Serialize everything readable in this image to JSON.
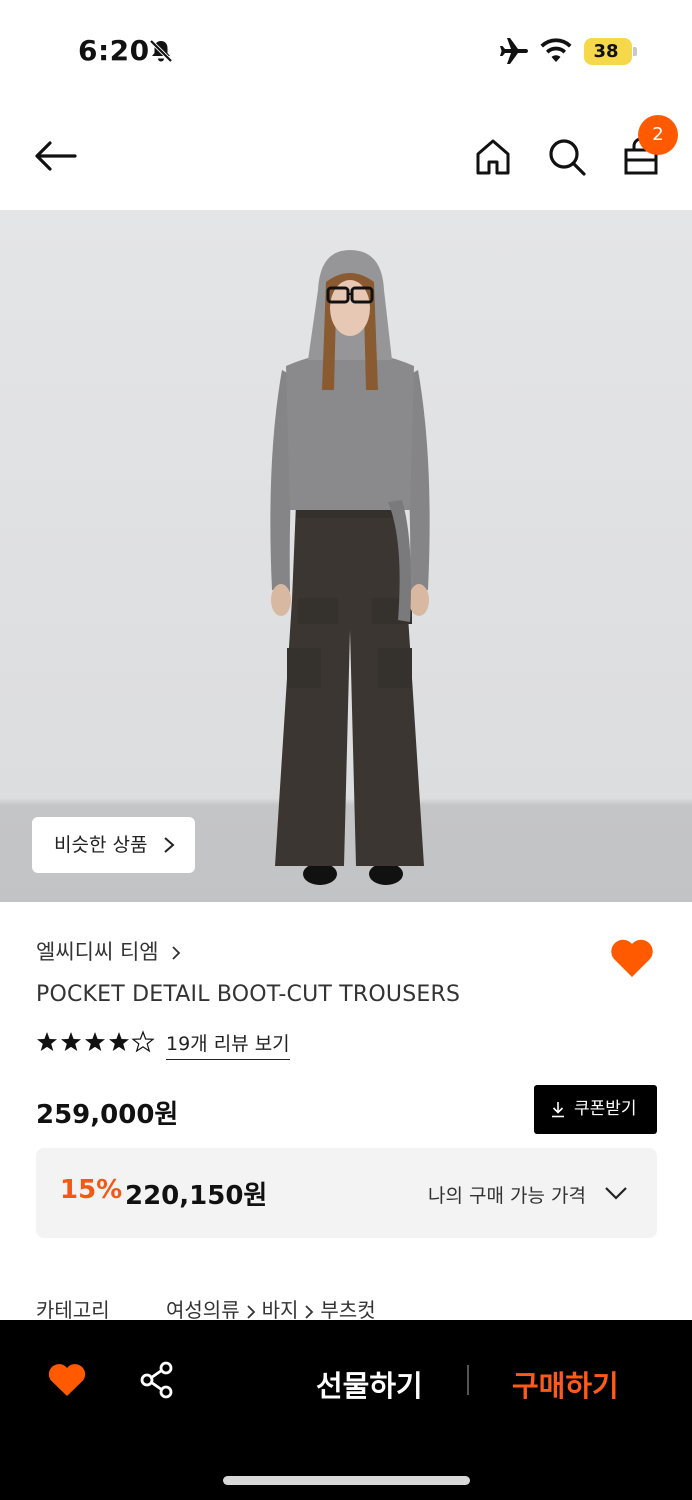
{
  "status_bar": {
    "time": "6:20",
    "battery": "38",
    "icons": [
      "bell-slash-icon",
      "airplane-icon",
      "wifi-icon",
      "battery-icon"
    ]
  },
  "top_nav": {
    "icons": [
      "back-arrow-icon",
      "home-icon",
      "search-icon",
      "shopping-bag-icon"
    ],
    "cart_count": "2"
  },
  "hero": {
    "similar_button_label": "비슷한 상품"
  },
  "product": {
    "brand": "엘씨디씨 티엠",
    "title": "POCKET DETAIL BOOT-CUT TROUSERS",
    "rating": 4.5,
    "review_link": "19개 리뷰 보기",
    "price": "259,000원",
    "coupon_label": "쿠폰받기",
    "discount_percent": "15%",
    "discount_price": "220,150원",
    "my_price_label": "나의 구매 가능 가격"
  },
  "category": {
    "label": "카테고리",
    "path": [
      "여성의류",
      "바지",
      "부츠컷"
    ]
  },
  "bottom_bar": {
    "gift_label": "선물하기",
    "buy_label": "구매하기"
  },
  "colors": {
    "accent": "#ff5a00",
    "discount": "#f15a16",
    "buy": "#ff5a1a",
    "badge_battery": "#f5d94a"
  }
}
